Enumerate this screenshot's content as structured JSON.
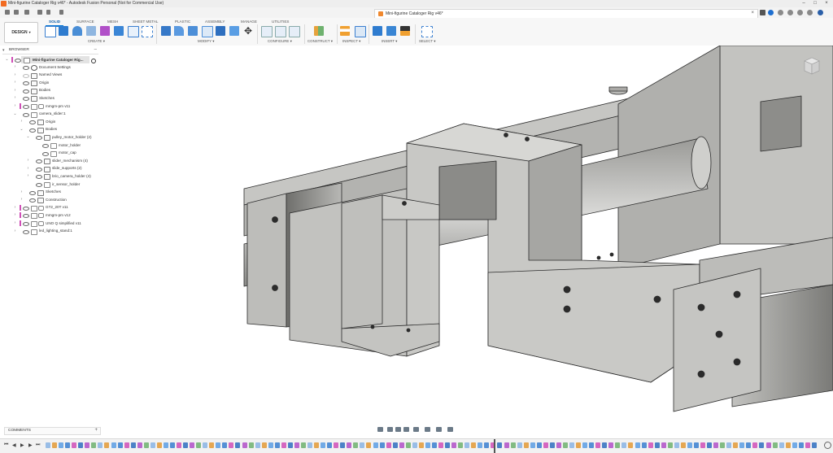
{
  "window": {
    "title": "Mini-figurine Cataloger Rig v46* - Autodesk Fusion Personal (Not for Commercial Use)",
    "minimize": "–",
    "maximize": "□",
    "close": "×"
  },
  "document_tab": {
    "title": "Mini-figurine Cataloger Rig v46*",
    "close": "×"
  },
  "ribbon": {
    "workspace": "DESIGN",
    "tabs": [
      "SOLID",
      "SURFACE",
      "MESH",
      "SHEET METAL",
      "PLASTIC",
      "ASSEMBLY",
      "MANAGE",
      "UTILITIES"
    ],
    "active_tab": "SOLID",
    "groups": [
      "CREATE ▾",
      "MODIFY ▾",
      "CONFIGURE ▾",
      "CONSTRUCT ▾",
      "INSPECT ▾",
      "INSERT ▾",
      "SELECT ▾"
    ]
  },
  "browser": {
    "header": "BROWSER",
    "collapse": "–",
    "root": "Mini-figurine Cataloger Rig...",
    "items": [
      {
        "label": "Document Settings",
        "icon": "gear-icon"
      },
      {
        "label": "Named Views",
        "icon": "folder-icon"
      },
      {
        "label": "Origin",
        "icon": "folder-icon"
      },
      {
        "label": "Bodies",
        "icon": "folder-icon"
      },
      {
        "label": "Sketches",
        "icon": "folder-icon"
      },
      {
        "label": "mmgm-pm v11",
        "icon": "component-link-icon"
      },
      {
        "label": "camera_slider:1",
        "icon": "component-icon"
      },
      {
        "label": "Origin",
        "icon": "folder-icon"
      },
      {
        "label": "Bodies",
        "icon": "folder-icon"
      },
      {
        "label": "pulley_motor_holder (2)",
        "icon": "folder-icon"
      },
      {
        "label": "motor_holder",
        "icon": "body-icon"
      },
      {
        "label": "motor_cap",
        "icon": "body-icon"
      },
      {
        "label": "slider_mechanism (4)",
        "icon": "folder-icon"
      },
      {
        "label": "slide_supports (2)",
        "icon": "folder-icon"
      },
      {
        "label": "brio_camera_holder (4)",
        "icon": "folder-icon"
      },
      {
        "label": "ir_sensor_holder",
        "icon": "body-icon"
      },
      {
        "label": "Sketches",
        "icon": "folder-icon"
      },
      {
        "label": "Construction",
        "icon": "folder-icon"
      },
      {
        "label": "GT2_20T v11",
        "icon": "component-link-icon"
      },
      {
        "label": "mmgm-pm v12",
        "icon": "component-link-icon"
      },
      {
        "label": "UNO Q simplified v11",
        "icon": "component-link-icon"
      },
      {
        "label": "led_lighting_stand:1",
        "icon": "component-icon"
      }
    ]
  },
  "viewcube": {
    "face_label": "BACK"
  },
  "comments": {
    "label": "COMMENTS",
    "add": "+"
  },
  "timeline": {
    "controls": [
      "⏮",
      "◀",
      "▶",
      "▶",
      "⏭"
    ]
  },
  "colors": {
    "accent": "#0a78d4",
    "model_face": "#c9c9c7",
    "model_dark": "#8f8f8c",
    "model_edge": "#2b2b2b",
    "component_bar": "#d04fb7",
    "app_orange": "#f26b21"
  }
}
